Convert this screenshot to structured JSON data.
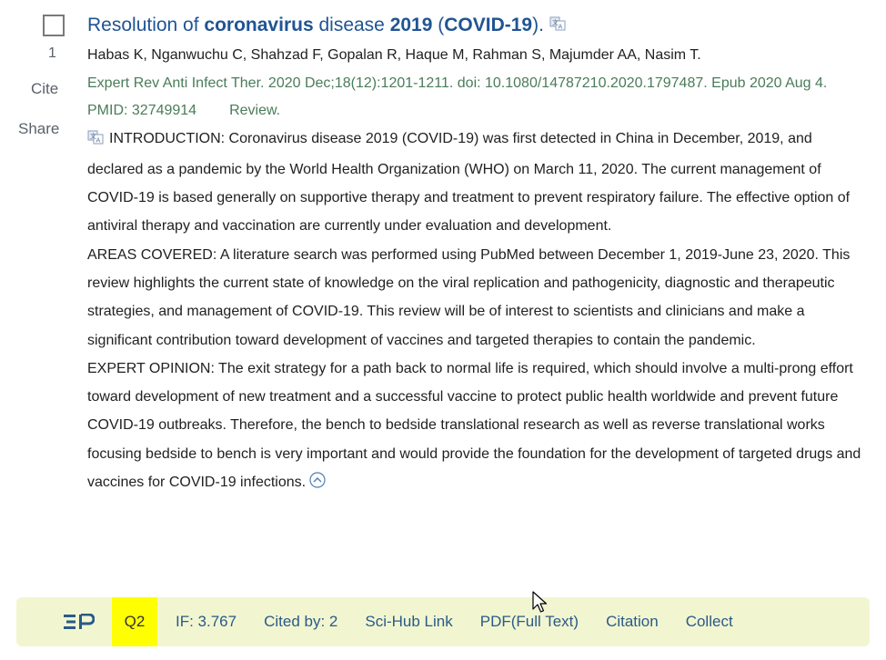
{
  "result": {
    "number": "1",
    "cite_label": "Cite",
    "share_label": "Share",
    "title": {
      "part1": "Resolution of ",
      "bold1": "coronavirus",
      "part2": " disease ",
      "bold2": "2019",
      "part3": " (",
      "bold3": "COVID-19",
      "part4": ")."
    },
    "authors": "Habas K, Nganwuchu C, Shahzad F, Gopalan R, Haque M, Rahman S, Majumder AA, Nasim T.",
    "citation": "Expert Rev Anti Infect Ther. 2020 Dec;18(12):1201-1211. doi: 10.1080/14787210.2020.1797487. Epub 2020 Aug 4.",
    "pmid": "PMID: 32749914",
    "type": "Review.",
    "abstract": {
      "introduction": "INTRODUCTION: Coronavirus disease 2019 (COVID-19) was first detected in China in December, 2019, and declared as a pandemic by the World Health Organization (WHO) on March 11, 2020. The current management of COVID-19 is based generally on supportive therapy and treatment to prevent respiratory failure. The effective option of antiviral therapy and vaccination are currently under evaluation and development.",
      "areas_covered": "AREAS COVERED: A literature search was performed using PubMed between December 1, 2019-June 23, 2020. This review highlights the current state of knowledge on the viral replication and pathogenicity, diagnostic and therapeutic strategies, and management of COVID-19. This review will be of interest to scientists and clinicians and make a significant contribution toward development of vaccines and targeted therapies to contain the pandemic.",
      "expert_opinion": "EXPERT OPINION: The exit strategy for a path back to normal life is required, which should involve a multi-prong effort toward development of new treatment and a successful vaccine to protect public health worldwide and prevent future COVID-19 outbreaks. Therefore, the bench to bedside translational research as well as reverse translational works focusing bedside to bench is very important and would provide the foundation for the development of targeted drugs and vaccines for COVID-19 infections."
    }
  },
  "toolbar": {
    "logo_icon": "ep-logo-icon",
    "quartile": "Q2",
    "impact_factor": "IF: 3.767",
    "cited_by": "Cited by: 2",
    "scihub": "Sci-Hub Link",
    "pdf": "PDF(Full Text)",
    "citation": "Citation",
    "collect": "Collect"
  },
  "colors": {
    "title_link": "#205493",
    "citation_green": "#4a7c59",
    "toolbar_bg": "#f2f6d0",
    "quartile_highlight": "#ffff00",
    "toolbar_text": "#2a5a8a"
  }
}
